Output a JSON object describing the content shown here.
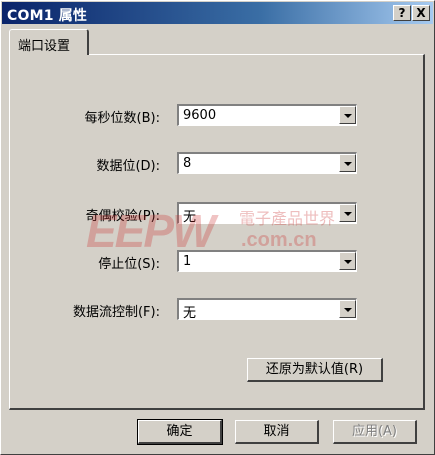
{
  "window": {
    "title": "COM1 属性"
  },
  "titlebar_buttons": {
    "help": "?",
    "close": "X"
  },
  "tabs": [
    {
      "label": "端口设置"
    }
  ],
  "fields": [
    {
      "label": "每秒位数(B):",
      "value": "9600"
    },
    {
      "label": "数据位(D):",
      "value": "8"
    },
    {
      "label": "奇偶校验(P):",
      "value": "无"
    },
    {
      "label": "停止位(S):",
      "value": "1"
    },
    {
      "label": "数据流控制(F):",
      "value": "无"
    }
  ],
  "restore_default_label": "还原为默认值(R)",
  "buttons": {
    "ok": "确定",
    "cancel": "取消",
    "apply": "应用(A)"
  },
  "watermark": {
    "logo": "EEPW",
    "tagline": "電子產品世界",
    "domain": ".com.cn"
  }
}
